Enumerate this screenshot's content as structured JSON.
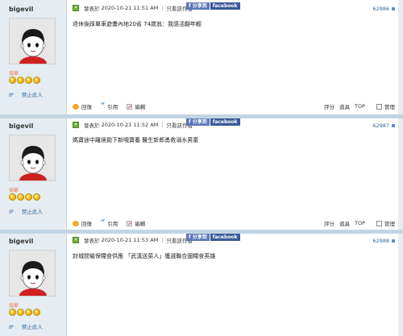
{
  "posts": [
    {
      "username": "bigevil",
      "rank": "侃爺",
      "ip_label": "IP",
      "ban_label": "禁止此人",
      "posted_label": "發表於",
      "timestamp": "2020-10-21 11:51 AM",
      "only_author": "只看該作者",
      "share_a": "f 分享到",
      "share_b": "facebook",
      "post_no": "62986",
      "message": "退休後踩單車遊畫內地20省 74歲翁：我感活翻年輕",
      "reply": "回復",
      "quote": "引用",
      "edit": "編輯",
      "rate": "評分",
      "tools": "道具",
      "top": "TOP",
      "manage": "管理"
    },
    {
      "username": "bigevil",
      "rank": "侃爺",
      "ip_label": "IP",
      "ban_label": "禁止此人",
      "posted_label": "發表於",
      "timestamp": "2020-10-21 11:52 AM",
      "only_author": "只看該作者",
      "share_a": "f 分享到",
      "share_b": "facebook",
      "post_no": "62987",
      "message": "媽寶途中離境拋下新哦寶養 醫生新郎勇救溺水男童",
      "reply": "回復",
      "quote": "引用",
      "edit": "編輯",
      "rate": "評分",
      "tools": "道具",
      "top": "TOP",
      "manage": "管理"
    },
    {
      "username": "bigevil",
      "rank": "侃爺",
      "ip_label": "IP",
      "ban_label": "禁止此人",
      "posted_label": "發表於",
      "timestamp": "2020-10-21 11:53 AM",
      "only_author": "只看該作者",
      "share_a": "f 分享到",
      "share_b": "facebook",
      "post_no": "62988",
      "message": "封城間催保糧食供應 「武漢送菜人」獲選聯合國糧食英雄",
      "reply": "回復",
      "quote": "引用",
      "edit": "編輯",
      "rate": "評分",
      "tools": "道具",
      "top": "TOP",
      "manage": "管理"
    }
  ],
  "colors": {
    "sidebar_bg": "#e5edf2",
    "separator": "#c2d5e3",
    "link": "#336699",
    "rank": "#f26c4f",
    "facebook": "#3b5998"
  }
}
